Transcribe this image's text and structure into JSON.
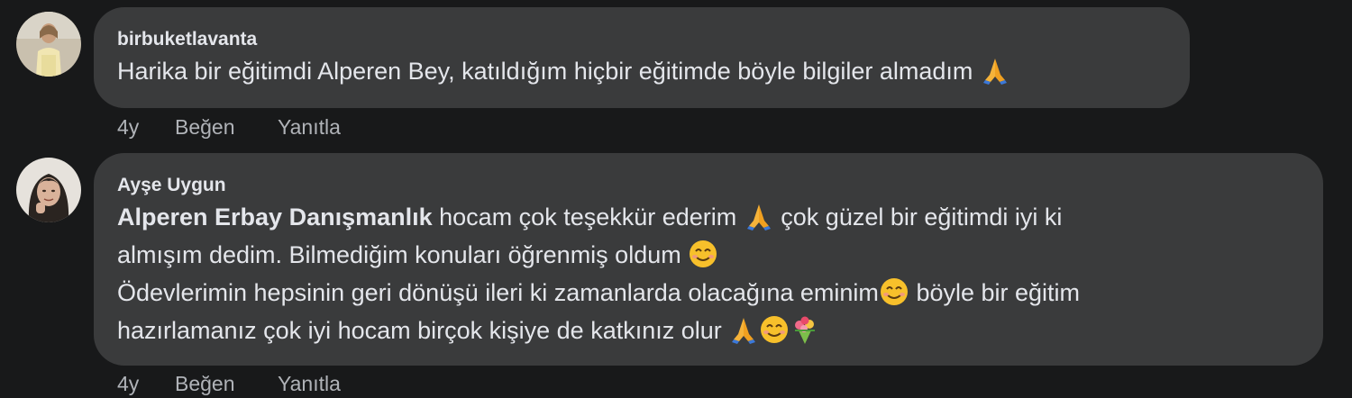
{
  "comments": [
    {
      "author": "birbuketlavanta",
      "lines": [
        {
          "text": "Harika bir eğitimdi Alperen Bey, katıldığım hiçbir eğitimde böyle bilgiler almadım ",
          "emoji": [
            "folded-hands"
          ]
        }
      ],
      "time": "4y",
      "like_label": "Beğen",
      "reply_label": "Yanıtla"
    },
    {
      "author": "Ayşe Uygun",
      "mention": "Alperen Erbay Danışmanlık",
      "line1_after_mention": " hocam çok teşekkür ederim ",
      "line1_tail": " çok güzel bir eğitimdi iyi ki",
      "line2": "almışım dedim. Bilmediğim konuları öğrenmiş oldum ",
      "line3_a": "Ödevlerimin hepsinin geri dönüşü ileri ki zamanlarda olacağına eminim",
      "line3_b": " böyle bir eğitim",
      "line4": "hazırlamanız çok iyi hocam birçok kişiye de katkınız olur ",
      "time": "4y",
      "like_label": "Beğen",
      "reply_label": "Yanıtla"
    }
  ],
  "colors": {
    "background": "#18191a",
    "bubble": "#3a3b3c",
    "text": "#e4e6eb",
    "secondary": "#b0b3b8"
  }
}
